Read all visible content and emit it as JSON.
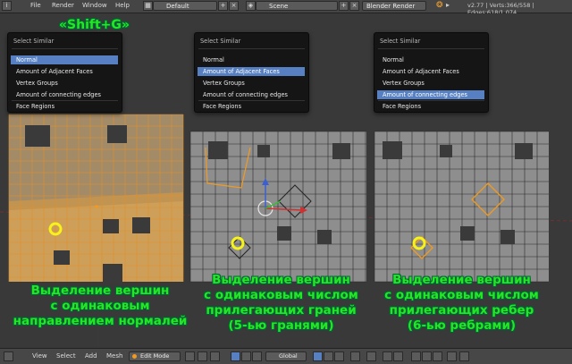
{
  "topbar": {
    "menus": [
      "File",
      "Render",
      "Window",
      "Help"
    ],
    "layout": "Default",
    "scene": "Scene",
    "engine": "Blender Render",
    "stats": "v2.77 | Verts:366/558 | Edges:618/1,074"
  },
  "popups": [
    {
      "title": "Select Similar",
      "items": [
        "Normal",
        "Amount of Adjacent Faces",
        "Vertex Groups",
        "Amount of connecting edges",
        "Face Regions"
      ],
      "selected": 0
    },
    {
      "title": "Select Similar",
      "items": [
        "Normal",
        "Amount of Adjacent Faces",
        "Vertex Groups",
        "Amount of connecting edges",
        "Face Regions"
      ],
      "selected": 1
    },
    {
      "title": "Select Similar",
      "items": [
        "Normal",
        "Amount of Adjacent Faces",
        "Vertex Groups",
        "Amount of connecting edges",
        "Face Regions"
      ],
      "selected": 3
    }
  ],
  "shortcut": "«Shift+G»",
  "captions": [
    [
      "Выделение вершин",
      "с одинаковым",
      "направлением нормалей"
    ],
    [
      "Выделение вершин",
      "с одинаковым числом",
      "прилегающих граней",
      "(5-ью гранями)"
    ],
    [
      "Выделение вершин",
      "с одинаковым числом",
      "прилегающих ребер",
      "(6-ью ребрами)"
    ]
  ],
  "bottombar": {
    "menus": [
      "View",
      "Select",
      "Add",
      "Mesh"
    ],
    "mode": "Edit Mode",
    "orientation": "Global"
  },
  "colors": {
    "selected": "#f39a1e",
    "highlight": "#5680c2",
    "caption": "#25e625",
    "mesh": "#8e8e8e"
  }
}
